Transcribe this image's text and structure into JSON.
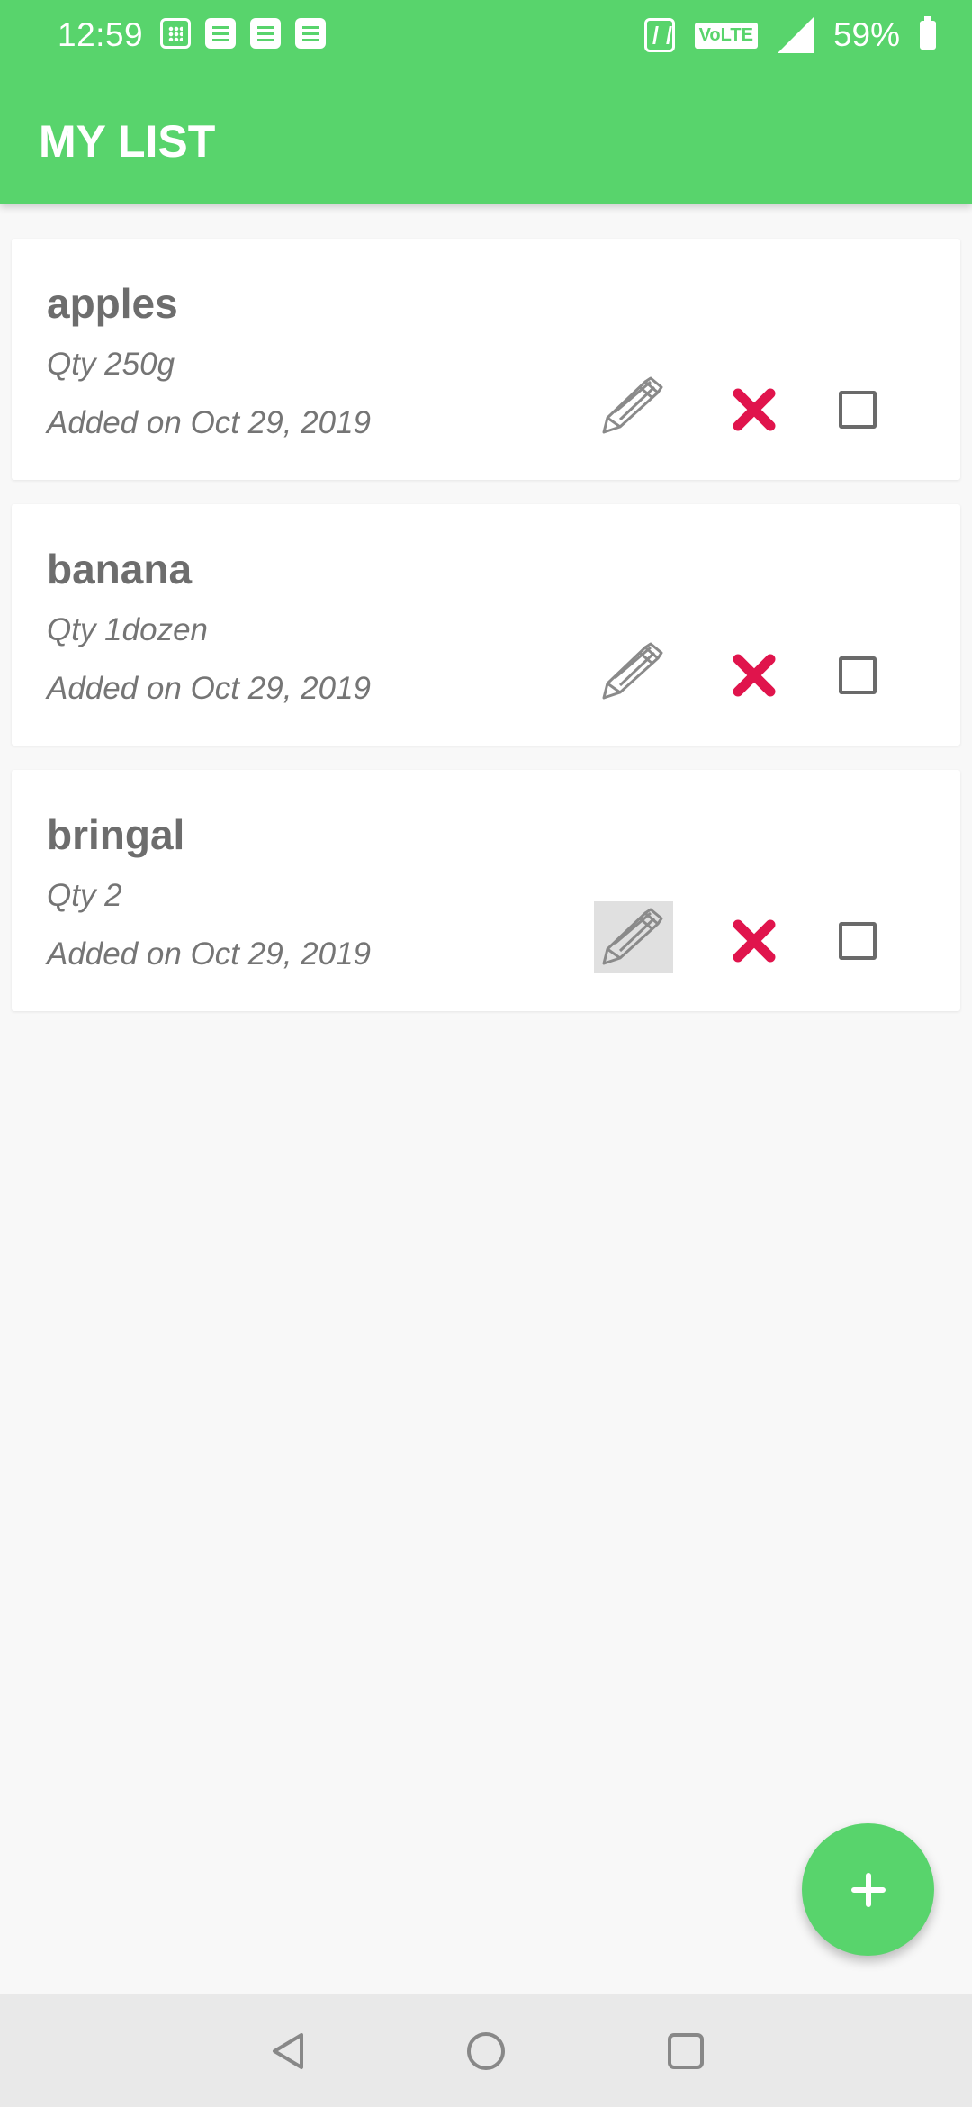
{
  "status_bar": {
    "time": "12:59",
    "volte": "VoLTE",
    "battery": "59%",
    "notification_icons": [
      "calculator-icon",
      "document-icon",
      "document-icon",
      "document-icon"
    ]
  },
  "app_bar": {
    "title": "MY LIST"
  },
  "items": [
    {
      "name": "apples",
      "qty": "Qty 250g",
      "date": "Added on Oct 29, 2019"
    },
    {
      "name": "banana",
      "qty": "Qty 1dozen",
      "date": "Added on Oct 29, 2019"
    },
    {
      "name": "bringal",
      "qty": "Qty 2",
      "date": "Added on Oct 29, 2019"
    }
  ],
  "colors": {
    "primary": "#58d46c",
    "delete": "#e0144c",
    "text_primary": "#6d6d6d",
    "text_secondary": "#757575",
    "background": "#f8f8f8"
  },
  "fab": {
    "icon": "plus-icon"
  },
  "nav_bar": {
    "icons": [
      "back-icon",
      "home-icon",
      "recents-icon"
    ]
  }
}
